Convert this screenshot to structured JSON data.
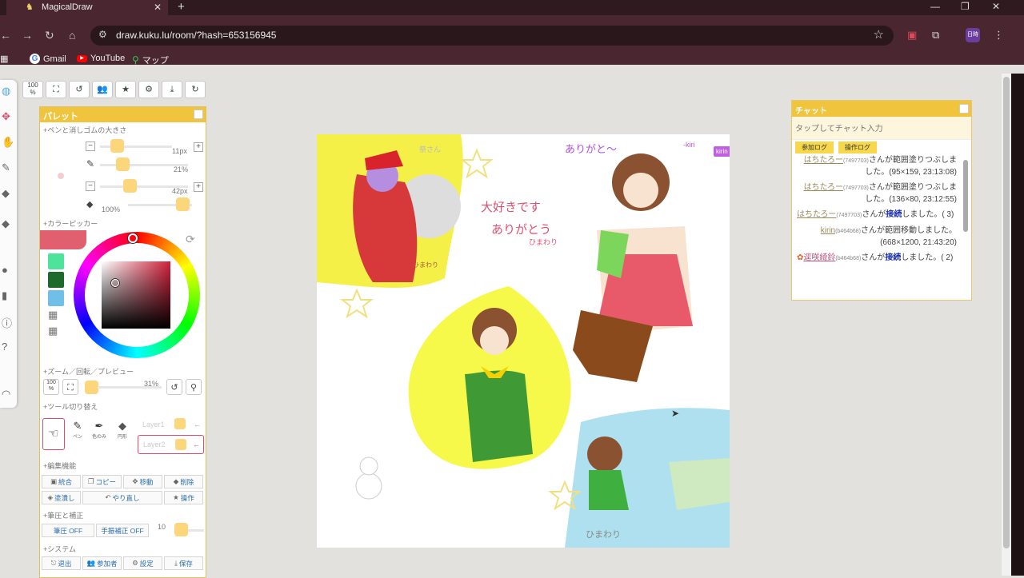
{
  "browser": {
    "tab_title": "MagicalDraw",
    "new_tab_symbol": "+",
    "close_symbol": "✕",
    "url": "draw.kuku.lu/room/?hash=653156945",
    "profile_label": "日時",
    "bookmarks": [
      "Gmail",
      "YouTube",
      "マップ"
    ]
  },
  "top_buttons": [
    "100\n%",
    "⛶",
    "↺",
    "👥",
    "★",
    "⚙",
    "⤓",
    "↻"
  ],
  "palette": {
    "title": "パレット",
    "sections": {
      "pen_size": "+ペンと消しゴムの大きさ",
      "color_picker": "+カラーピッカー",
      "zoom": "+ズーム／回転／プレビュー",
      "tool_switch": "+ツール切り替え",
      "edit": "+編集機能",
      "pressure": "+筆圧と補正",
      "system": "+システム"
    },
    "pen_px": "11px",
    "pen_opacity": "21%",
    "eraser_px": "42px",
    "eraser_opacity": "100%",
    "zoom_value": "31%",
    "zoom_100": "100\n%",
    "tools": [
      "ペン",
      "色のみ",
      "円形"
    ],
    "layers": [
      "Layer1",
      "Layer2"
    ],
    "edit_buttons": [
      "統合",
      "コピー",
      "移動",
      "削除",
      "塗潰し",
      "やり直し",
      "操作"
    ],
    "pressure_buttons": [
      "筆圧 OFF",
      "手振補正 OFF"
    ],
    "pressure_value": "10",
    "system_buttons": [
      "退出",
      "参加者",
      "設定",
      "保存"
    ]
  },
  "canvas": {
    "texts": [
      "ありがと〜",
      "-kiri",
      "大好きです",
      "ありがとう",
      "ひまわり",
      "ひまわり",
      "ひまわり",
      "祭さん"
    ],
    "badge": "kirin"
  },
  "chat": {
    "title": "チャット",
    "input_placeholder": "タップしてチャット入力",
    "tabs": [
      "参加ログ",
      "操作ログ"
    ],
    "messages": [
      {
        "user": "はちたろー",
        "id": "(7497703)",
        "text": "さんが範囲塗りつぶしました。(95×159, 23:13:08)"
      },
      {
        "user": "はちたろー",
        "id": "(7497703)",
        "text": "さんが範囲塗りつぶしました。(136×80, 23:12:55)"
      },
      {
        "user": "はちたろー",
        "id": "(7497703)",
        "text": "さんが",
        "bold": "接続",
        "tail": "しました。( 3)"
      },
      {
        "user": "kirin",
        "id": "(b464b68)",
        "text": "さんが範囲移動しました。(668×1200, 21:43:20)"
      },
      {
        "user": "逕咲綺鈴",
        "id": "(b464b68)",
        "text": "さんが",
        "bold": "接続",
        "tail": "しました。( 2)"
      }
    ]
  }
}
